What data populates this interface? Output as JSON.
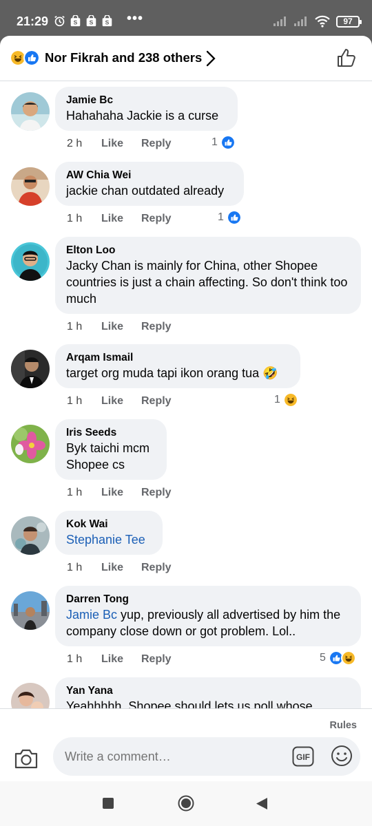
{
  "status_bar": {
    "time": "21:29",
    "icons": [
      "alarm-icon",
      "shopee-notification-icon",
      "shopee-notification-icon",
      "shopee-notification-icon"
    ],
    "more": "•••",
    "battery": "97"
  },
  "header": {
    "reactions_summary": "Nor Fikrah and 238 others",
    "reaction_icons": [
      "haha-icon",
      "like-icon"
    ]
  },
  "comments": [
    {
      "author": "Jamie Bc",
      "text": "Hahahaha Jackie is a curse",
      "time": "2 h",
      "like": "Like",
      "reply": "Reply",
      "reaction_count": "1",
      "reactions": [
        "like"
      ]
    },
    {
      "author": "AW Chia Wei",
      "text": "jackie chan outdated already",
      "time": "1 h",
      "like": "Like",
      "reply": "Reply",
      "reaction_count": "1",
      "reactions": [
        "like"
      ]
    },
    {
      "author": "Elton Loo",
      "text": "Jacky Chan is mainly for China, other Shopee countries is just a chain affecting. So don't think too much",
      "time": "1 h",
      "like": "Like",
      "reply": "Reply",
      "reaction_count": "",
      "reactions": []
    },
    {
      "author": "Arqam Ismail",
      "text": "target org muda tapi ikon orang tua 🤣",
      "time": "1 h",
      "like": "Like",
      "reply": "Reply",
      "reaction_count": "1",
      "reactions": [
        "haha"
      ]
    },
    {
      "author": "Iris Seeds",
      "text": "Byk taichi mcm Shopee cs",
      "time": "1 h",
      "like": "Like",
      "reply": "Reply",
      "reaction_count": "",
      "reactions": []
    },
    {
      "author": "Kok Wai",
      "mention": "Stephanie Tee",
      "text": "",
      "time": "1 h",
      "like": "Like",
      "reply": "Reply",
      "reaction_count": "",
      "reactions": []
    },
    {
      "author": "Darren Tong",
      "mention": "Jamie Bc",
      "text": " yup, previously all advertised by him the company close down or got problem. Lol..",
      "time": "1 h",
      "like": "Like",
      "reply": "Reply",
      "reaction_count": "5",
      "reactions": [
        "like",
        "haha"
      ]
    },
    {
      "author": "Yan Yana",
      "text": "Yeahhhhh, Shopee should lets us poll whose",
      "time": "",
      "like": "",
      "reply": "",
      "reaction_count": "",
      "reactions": []
    }
  ],
  "composer": {
    "rules": "Rules",
    "placeholder": "Write a comment…",
    "gif": "GIF"
  },
  "colors": {
    "accent_blue": "#1877f2",
    "bubble_bg": "#f0f2f5",
    "mention_blue": "#1b5fb6",
    "haha_yellow": "#f7b928"
  }
}
